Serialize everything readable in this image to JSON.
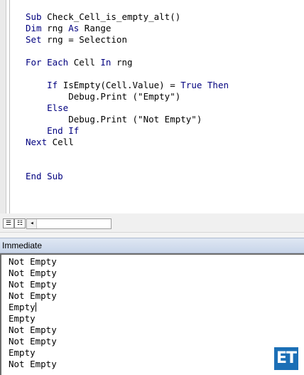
{
  "code_lines": [
    {
      "pre": "",
      "kw1": "Sub",
      "mid": " Check_Cell_is_empty_alt()",
      "kw2": "",
      "post": ""
    },
    {
      "pre": "",
      "kw1": "Dim",
      "mid": " rng ",
      "kw2": "As",
      "post": " Range"
    },
    {
      "pre": "",
      "kw1": "Set",
      "mid": " rng = Selection",
      "kw2": "",
      "post": ""
    },
    {
      "pre": "",
      "kw1": "",
      "mid": "",
      "kw2": "",
      "post": ""
    },
    {
      "pre": "",
      "kw1": "For Each",
      "mid": " Cell ",
      "kw2": "In",
      "post": " rng"
    },
    {
      "pre": "",
      "kw1": "",
      "mid": "",
      "kw2": "",
      "post": ""
    },
    {
      "pre": "    ",
      "kw1": "If",
      "mid": " IsEmpty(Cell.Value) = ",
      "kw2": "True Then",
      "post": ""
    },
    {
      "pre": "        ",
      "kw1": "",
      "mid": "Debug.Print (\"Empty\")",
      "kw2": "",
      "post": ""
    },
    {
      "pre": "    ",
      "kw1": "Else",
      "mid": "",
      "kw2": "",
      "post": ""
    },
    {
      "pre": "        ",
      "kw1": "",
      "mid": "Debug.Print (\"Not Empty\")",
      "kw2": "",
      "post": ""
    },
    {
      "pre": "    ",
      "kw1": "End If",
      "mid": "",
      "kw2": "",
      "post": ""
    },
    {
      "pre": "",
      "kw1": "Next",
      "mid": " Cell",
      "kw2": "",
      "post": ""
    },
    {
      "pre": "",
      "kw1": "",
      "mid": "",
      "kw2": "",
      "post": ""
    },
    {
      "pre": "",
      "kw1": "",
      "mid": "",
      "kw2": "",
      "post": ""
    },
    {
      "pre": "",
      "kw1": "End Sub",
      "mid": "",
      "kw2": "",
      "post": ""
    }
  ],
  "immediate": {
    "title": "Immediate",
    "lines": [
      "Not Empty",
      "Not Empty",
      "Not Empty",
      "Not Empty",
      "Empty",
      "Empty",
      "Not Empty",
      "Not Empty",
      "Empty",
      "Not Empty"
    ],
    "caret_line": 4
  },
  "controls": {
    "procedure_view_icon": "procedure-view-icon",
    "full_module_view_icon": "full-module-view-icon",
    "scroll_left_icon": "scroll-left-arrow-icon"
  },
  "logo": {
    "text": "ET",
    "color": "#1b6fb6"
  },
  "colors": {
    "keyword": "#00007f",
    "text": "#000000"
  }
}
